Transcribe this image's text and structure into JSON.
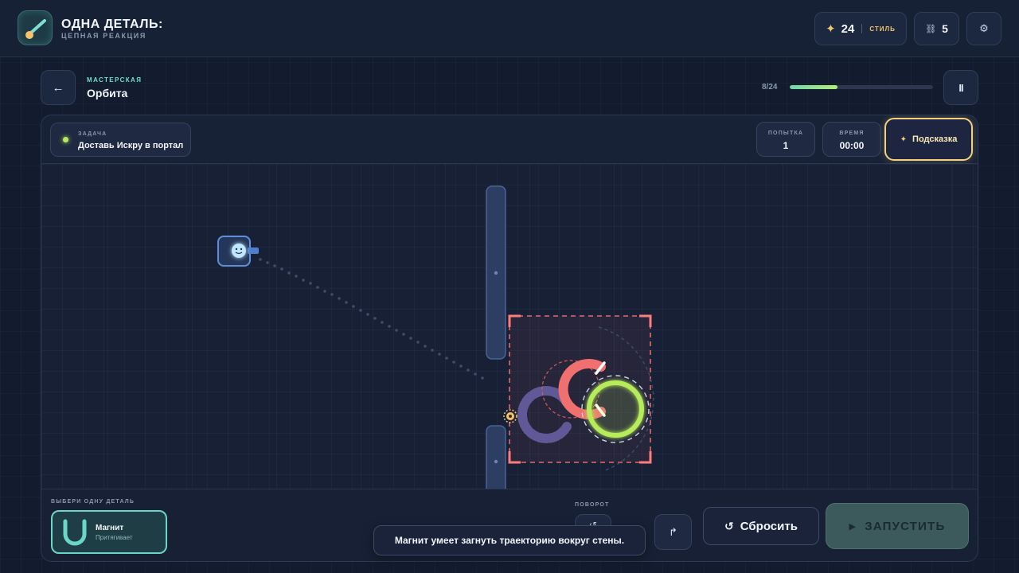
{
  "app": {
    "title": "ОДНА ДЕТАЛЬ:",
    "subtitle": "ЦЕПНАЯ РЕАКЦИЯ"
  },
  "stats": {
    "stars": "24",
    "style_label": "СТИЛЬ",
    "links": "5"
  },
  "level": {
    "category": "МАСТЕРСКАЯ",
    "name": "Орбита",
    "progress_text": "8/24",
    "progress": 0.333
  },
  "task": {
    "label": "ЗАДАЧА",
    "text": "Доставь Искру в портал"
  },
  "attempt": {
    "label": "ПОПЫТКА",
    "value": "1"
  },
  "time": {
    "label": "ВРЕМЯ",
    "value": "00:00"
  },
  "hint_label": "Подсказка",
  "parts": {
    "label": "ВЫБЕРИ ОДНУ ДЕТАЛЬ",
    "selected": {
      "name": "Магнит",
      "desc": "Притягивает"
    }
  },
  "rotation": {
    "label": "ПОВОРОТ"
  },
  "buttons": {
    "reset": "Сбросить",
    "run": "ЗАПУСТИТЬ"
  },
  "toast": "Магнит умеет загнуть траекторию вокруг стены.",
  "colors": {
    "accent_teal": "#6ad6c6",
    "hint_gold": "#f4cf7e",
    "portal_green": "#b6ec5a",
    "magnet_red": "#f07070",
    "magnet_ghost": "#7a6fb4"
  },
  "icons": {
    "back": "arrow-left-icon",
    "pause": "pause-icon",
    "settings": "gear-icon",
    "star": "star-icon",
    "link": "chain-icon"
  }
}
